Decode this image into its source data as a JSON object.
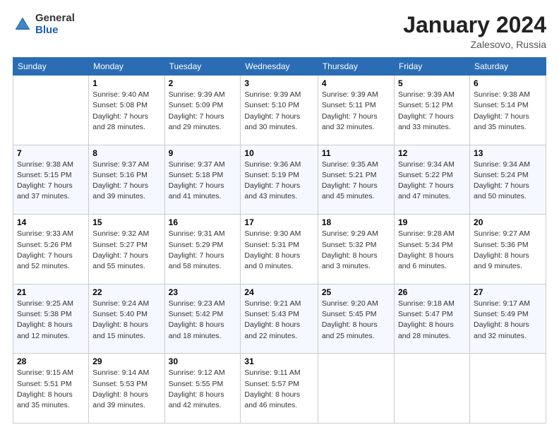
{
  "header": {
    "logo_general": "General",
    "logo_blue": "Blue",
    "month_title": "January 2024",
    "location": "Zalesovo, Russia"
  },
  "weekdays": [
    "Sunday",
    "Monday",
    "Tuesday",
    "Wednesday",
    "Thursday",
    "Friday",
    "Saturday"
  ],
  "weeks": [
    [
      {
        "day": "",
        "sunrise": "",
        "sunset": "",
        "daylight": ""
      },
      {
        "day": "1",
        "sunrise": "Sunrise: 9:40 AM",
        "sunset": "Sunset: 5:08 PM",
        "daylight": "Daylight: 7 hours and 28 minutes."
      },
      {
        "day": "2",
        "sunrise": "Sunrise: 9:39 AM",
        "sunset": "Sunset: 5:09 PM",
        "daylight": "Daylight: 7 hours and 29 minutes."
      },
      {
        "day": "3",
        "sunrise": "Sunrise: 9:39 AM",
        "sunset": "Sunset: 5:10 PM",
        "daylight": "Daylight: 7 hours and 30 minutes."
      },
      {
        "day": "4",
        "sunrise": "Sunrise: 9:39 AM",
        "sunset": "Sunset: 5:11 PM",
        "daylight": "Daylight: 7 hours and 32 minutes."
      },
      {
        "day": "5",
        "sunrise": "Sunrise: 9:39 AM",
        "sunset": "Sunset: 5:12 PM",
        "daylight": "Daylight: 7 hours and 33 minutes."
      },
      {
        "day": "6",
        "sunrise": "Sunrise: 9:38 AM",
        "sunset": "Sunset: 5:14 PM",
        "daylight": "Daylight: 7 hours and 35 minutes."
      }
    ],
    [
      {
        "day": "7",
        "sunrise": "Sunrise: 9:38 AM",
        "sunset": "Sunset: 5:15 PM",
        "daylight": "Daylight: 7 hours and 37 minutes."
      },
      {
        "day": "8",
        "sunrise": "Sunrise: 9:37 AM",
        "sunset": "Sunset: 5:16 PM",
        "daylight": "Daylight: 7 hours and 39 minutes."
      },
      {
        "day": "9",
        "sunrise": "Sunrise: 9:37 AM",
        "sunset": "Sunset: 5:18 PM",
        "daylight": "Daylight: 7 hours and 41 minutes."
      },
      {
        "day": "10",
        "sunrise": "Sunrise: 9:36 AM",
        "sunset": "Sunset: 5:19 PM",
        "daylight": "Daylight: 7 hours and 43 minutes."
      },
      {
        "day": "11",
        "sunrise": "Sunrise: 9:35 AM",
        "sunset": "Sunset: 5:21 PM",
        "daylight": "Daylight: 7 hours and 45 minutes."
      },
      {
        "day": "12",
        "sunrise": "Sunrise: 9:34 AM",
        "sunset": "Sunset: 5:22 PM",
        "daylight": "Daylight: 7 hours and 47 minutes."
      },
      {
        "day": "13",
        "sunrise": "Sunrise: 9:34 AM",
        "sunset": "Sunset: 5:24 PM",
        "daylight": "Daylight: 7 hours and 50 minutes."
      }
    ],
    [
      {
        "day": "14",
        "sunrise": "Sunrise: 9:33 AM",
        "sunset": "Sunset: 5:26 PM",
        "daylight": "Daylight: 7 hours and 52 minutes."
      },
      {
        "day": "15",
        "sunrise": "Sunrise: 9:32 AM",
        "sunset": "Sunset: 5:27 PM",
        "daylight": "Daylight: 7 hours and 55 minutes."
      },
      {
        "day": "16",
        "sunrise": "Sunrise: 9:31 AM",
        "sunset": "Sunset: 5:29 PM",
        "daylight": "Daylight: 7 hours and 58 minutes."
      },
      {
        "day": "17",
        "sunrise": "Sunrise: 9:30 AM",
        "sunset": "Sunset: 5:31 PM",
        "daylight": "Daylight: 8 hours and 0 minutes."
      },
      {
        "day": "18",
        "sunrise": "Sunrise: 9:29 AM",
        "sunset": "Sunset: 5:32 PM",
        "daylight": "Daylight: 8 hours and 3 minutes."
      },
      {
        "day": "19",
        "sunrise": "Sunrise: 9:28 AM",
        "sunset": "Sunset: 5:34 PM",
        "daylight": "Daylight: 8 hours and 6 minutes."
      },
      {
        "day": "20",
        "sunrise": "Sunrise: 9:27 AM",
        "sunset": "Sunset: 5:36 PM",
        "daylight": "Daylight: 8 hours and 9 minutes."
      }
    ],
    [
      {
        "day": "21",
        "sunrise": "Sunrise: 9:25 AM",
        "sunset": "Sunset: 5:38 PM",
        "daylight": "Daylight: 8 hours and 12 minutes."
      },
      {
        "day": "22",
        "sunrise": "Sunrise: 9:24 AM",
        "sunset": "Sunset: 5:40 PM",
        "daylight": "Daylight: 8 hours and 15 minutes."
      },
      {
        "day": "23",
        "sunrise": "Sunrise: 9:23 AM",
        "sunset": "Sunset: 5:42 PM",
        "daylight": "Daylight: 8 hours and 18 minutes."
      },
      {
        "day": "24",
        "sunrise": "Sunrise: 9:21 AM",
        "sunset": "Sunset: 5:43 PM",
        "daylight": "Daylight: 8 hours and 22 minutes."
      },
      {
        "day": "25",
        "sunrise": "Sunrise: 9:20 AM",
        "sunset": "Sunset: 5:45 PM",
        "daylight": "Daylight: 8 hours and 25 minutes."
      },
      {
        "day": "26",
        "sunrise": "Sunrise: 9:18 AM",
        "sunset": "Sunset: 5:47 PM",
        "daylight": "Daylight: 8 hours and 28 minutes."
      },
      {
        "day": "27",
        "sunrise": "Sunrise: 9:17 AM",
        "sunset": "Sunset: 5:49 PM",
        "daylight": "Daylight: 8 hours and 32 minutes."
      }
    ],
    [
      {
        "day": "28",
        "sunrise": "Sunrise: 9:15 AM",
        "sunset": "Sunset: 5:51 PM",
        "daylight": "Daylight: 8 hours and 35 minutes."
      },
      {
        "day": "29",
        "sunrise": "Sunrise: 9:14 AM",
        "sunset": "Sunset: 5:53 PM",
        "daylight": "Daylight: 8 hours and 39 minutes."
      },
      {
        "day": "30",
        "sunrise": "Sunrise: 9:12 AM",
        "sunset": "Sunset: 5:55 PM",
        "daylight": "Daylight: 8 hours and 42 minutes."
      },
      {
        "day": "31",
        "sunrise": "Sunrise: 9:11 AM",
        "sunset": "Sunset: 5:57 PM",
        "daylight": "Daylight: 8 hours and 46 minutes."
      },
      {
        "day": "",
        "sunrise": "",
        "sunset": "",
        "daylight": ""
      },
      {
        "day": "",
        "sunrise": "",
        "sunset": "",
        "daylight": ""
      },
      {
        "day": "",
        "sunrise": "",
        "sunset": "",
        "daylight": ""
      }
    ]
  ]
}
